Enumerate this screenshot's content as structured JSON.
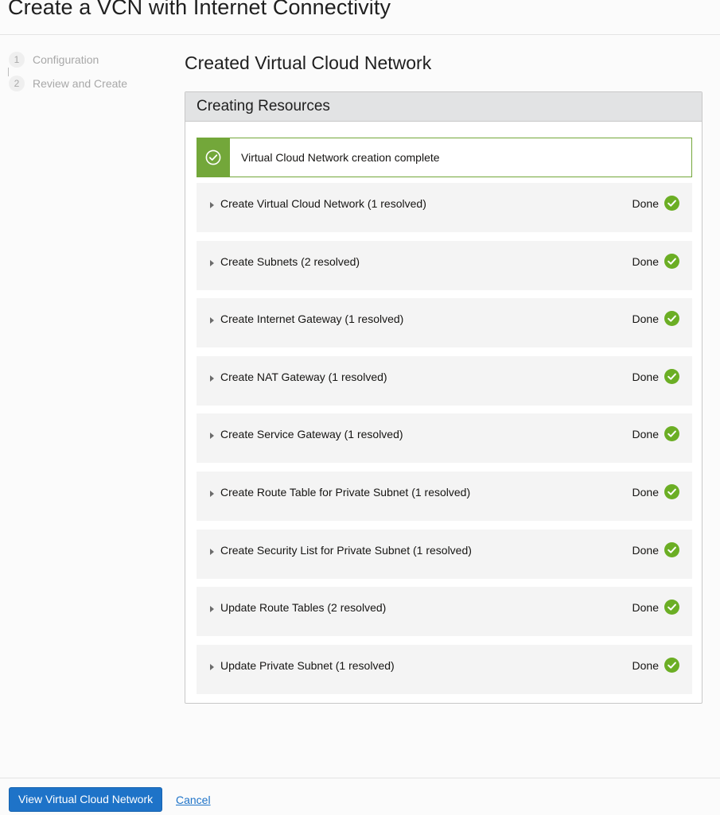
{
  "page": {
    "title": "Create a VCN with Internet Connectivity"
  },
  "steps": [
    {
      "number": "1",
      "label": "Configuration"
    },
    {
      "number": "2",
      "label": "Review and Create"
    }
  ],
  "main": {
    "section_title": "Created Virtual Cloud Network",
    "panel_title": "Creating Resources",
    "success_message": "Virtual Cloud Network creation complete",
    "tasks": [
      {
        "label": "Create Virtual Cloud Network (1 resolved)",
        "status": "Done"
      },
      {
        "label": "Create Subnets (2 resolved)",
        "status": "Done"
      },
      {
        "label": "Create Internet Gateway (1 resolved)",
        "status": "Done"
      },
      {
        "label": "Create NAT Gateway (1 resolved)",
        "status": "Done"
      },
      {
        "label": "Create Service Gateway (1 resolved)",
        "status": "Done"
      },
      {
        "label": "Create Route Table for Private Subnet (1 resolved)",
        "status": "Done"
      },
      {
        "label": "Create Security List for Private Subnet (1 resolved)",
        "status": "Done"
      },
      {
        "label": "Update Route Tables (2 resolved)",
        "status": "Done"
      },
      {
        "label": "Update Private Subnet (1 resolved)",
        "status": "Done"
      }
    ]
  },
  "footer": {
    "primary_button_label": "View Virtual Cloud Network",
    "cancel_label": "Cancel"
  },
  "colors": {
    "success_green": "#73a73a",
    "check_green": "#6bae24",
    "primary_blue": "#1e73c8"
  },
  "icons": {
    "success": "check-circle-icon",
    "expand": "caret-right-icon",
    "status": "check-circle-icon"
  }
}
